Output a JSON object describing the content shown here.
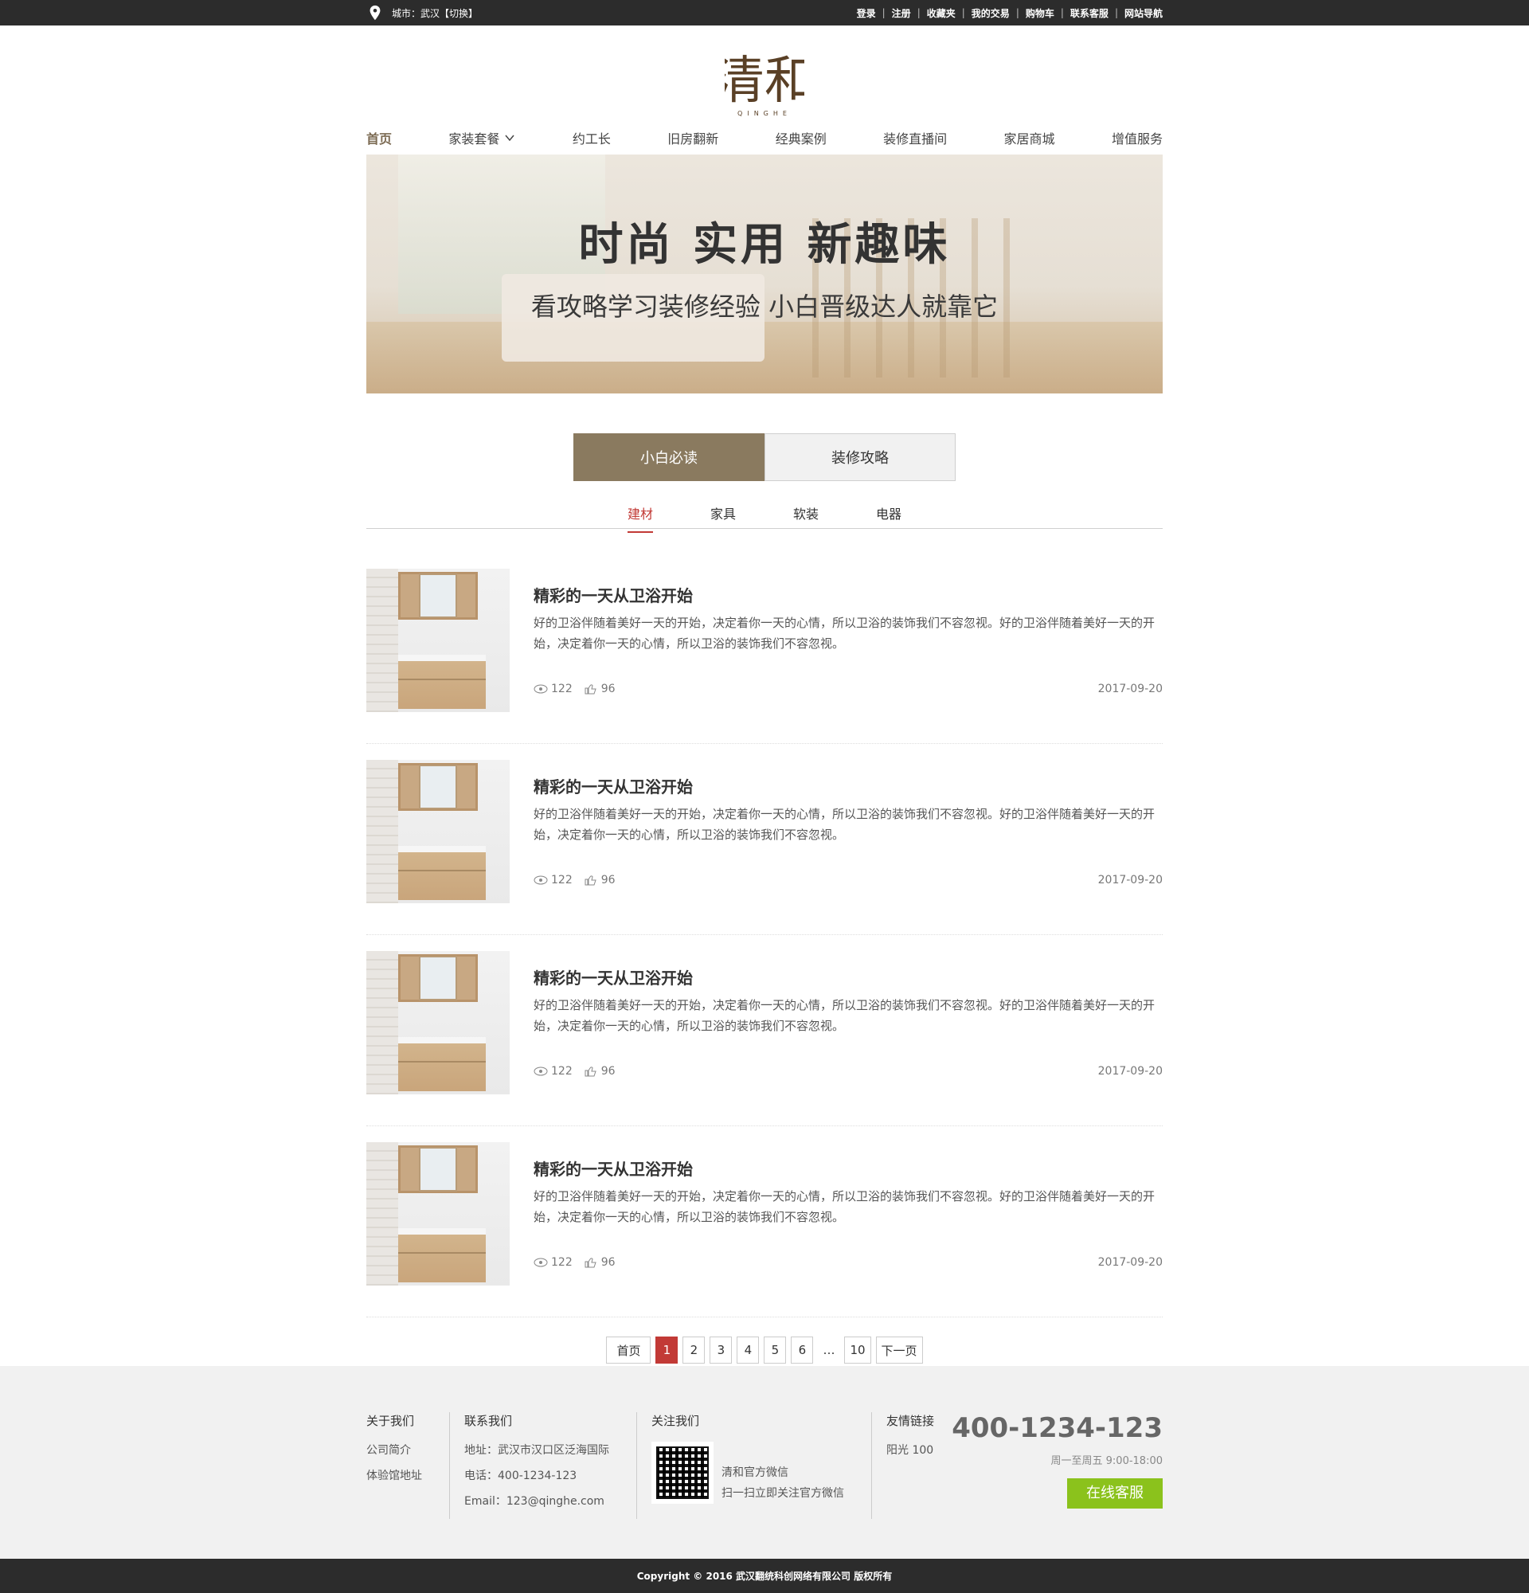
{
  "topbar": {
    "city_text": "城市：武汉【切换】",
    "links": [
      "登录",
      "注册",
      "收藏夹",
      "我的交易",
      "购物车",
      "联系客服",
      "网站导航"
    ]
  },
  "logo": {
    "text": "清和",
    "sub": "QINGHE"
  },
  "nav": [
    {
      "label": "首页",
      "active": true
    },
    {
      "label": "家装套餐",
      "dropdown": true
    },
    {
      "label": "约工长"
    },
    {
      "label": "旧房翻新"
    },
    {
      "label": "经典案例"
    },
    {
      "label": "装修直播间"
    },
    {
      "label": "家居商城"
    },
    {
      "label": "增值服务"
    }
  ],
  "banner": {
    "title": "时尚  实用  新趣味",
    "subtitle": "看攻略学习装修经验    小白晋级达人就靠它"
  },
  "tabs": {
    "active": "小白必读",
    "inactive": "装修攻略"
  },
  "subtabs": [
    "建材",
    "家具",
    "软装",
    "电器"
  ],
  "articles": [
    {
      "title": "精彩的一天从卫浴开始",
      "desc": "好的卫浴伴随着美好一天的开始，决定着你一天的心情，所以卫浴的装饰我们不容忽视。好的卫浴伴随着美好一天的开始，决定着你一天的心情，所以卫浴的装饰我们不容忽视。",
      "views": "122",
      "likes": "96",
      "date": "2017-09-20"
    },
    {
      "title": "精彩的一天从卫浴开始",
      "desc": "好的卫浴伴随着美好一天的开始，决定着你一天的心情，所以卫浴的装饰我们不容忽视。好的卫浴伴随着美好一天的开始，决定着你一天的心情，所以卫浴的装饰我们不容忽视。",
      "views": "122",
      "likes": "96",
      "date": "2017-09-20"
    },
    {
      "title": "精彩的一天从卫浴开始",
      "desc": "好的卫浴伴随着美好一天的开始，决定着你一天的心情，所以卫浴的装饰我们不容忽视。好的卫浴伴随着美好一天的开始，决定着你一天的心情，所以卫浴的装饰我们不容忽视。",
      "views": "122",
      "likes": "96",
      "date": "2017-09-20"
    },
    {
      "title": "精彩的一天从卫浴开始",
      "desc": "好的卫浴伴随着美好一天的开始，决定着你一天的心情，所以卫浴的装饰我们不容忽视。好的卫浴伴随着美好一天的开始，决定着你一天的心情，所以卫浴的装饰我们不容忽视。",
      "views": "122",
      "likes": "96",
      "date": "2017-09-20"
    }
  ],
  "pager": {
    "first": "首页",
    "pages": [
      "1",
      "2",
      "3",
      "4",
      "5",
      "6"
    ],
    "current": "1",
    "ellipsis": "…",
    "last_page": "10",
    "next": "下一页"
  },
  "footer": {
    "about": {
      "title": "关于我们",
      "items": [
        "公司简介",
        "体验馆地址"
      ]
    },
    "contact": {
      "title": "联系我们",
      "address": "地址：武汉市汉口区泛海国际",
      "phone": "电话：400-1234-123",
      "email": "Email：123@qinghe.com"
    },
    "follow": {
      "title": "关注我们",
      "line1": "清和官方微信",
      "line2": "扫一扫立即关注官方微信"
    },
    "links": {
      "title": "友情链接",
      "items": [
        "阳光 100"
      ]
    },
    "hotline": "400-1234-123",
    "hours": "周一至周五  9:00-18:00",
    "service_button": "在线客服"
  },
  "copyright": "Copyright © 2016 武汉翻统科创网络有限公司 版权所有"
}
